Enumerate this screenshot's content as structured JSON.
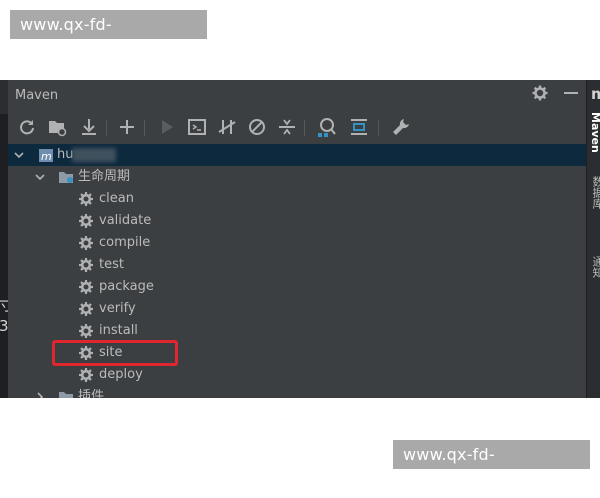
{
  "watermark": {
    "top": "www.qx-fd-kaiyun.com",
    "bottom": "www.qx-fd-kaiyun.com"
  },
  "gutter": {
    "glyph1": "寸",
    "glyph2": "3"
  },
  "panel": {
    "title": "Maven",
    "title_icons": [
      "gear-icon",
      "minimize-icon"
    ]
  },
  "toolbar": {
    "buttons": [
      "reload-icon",
      "generate-sources-icon",
      "download-icon",
      "add-icon",
      "run-icon",
      "execute-goal-icon",
      "toggle-offline-icon",
      "skip-tests-icon",
      "collapse-all-icon",
      "analyze-dependencies-icon",
      "show-diagram-icon",
      "settings-wrench-icon"
    ]
  },
  "tree": {
    "project_label": "hu",
    "lifecycle_label": "生命周期",
    "phases": [
      "clean",
      "validate",
      "compile",
      "test",
      "package",
      "verify",
      "install",
      "site",
      "deploy"
    ],
    "plugins_label": "插件",
    "highlighted_phase": "package"
  },
  "right_strip": {
    "header": "m",
    "tabs": [
      "Maven",
      "数据库",
      "通知"
    ]
  },
  "colors": {
    "panel_bg": "#3c3f41",
    "selection": "#0d293e",
    "text": "#bbbbbb",
    "highlight_border": "#e0262f",
    "watermark_bg": "#a9a9a9"
  }
}
